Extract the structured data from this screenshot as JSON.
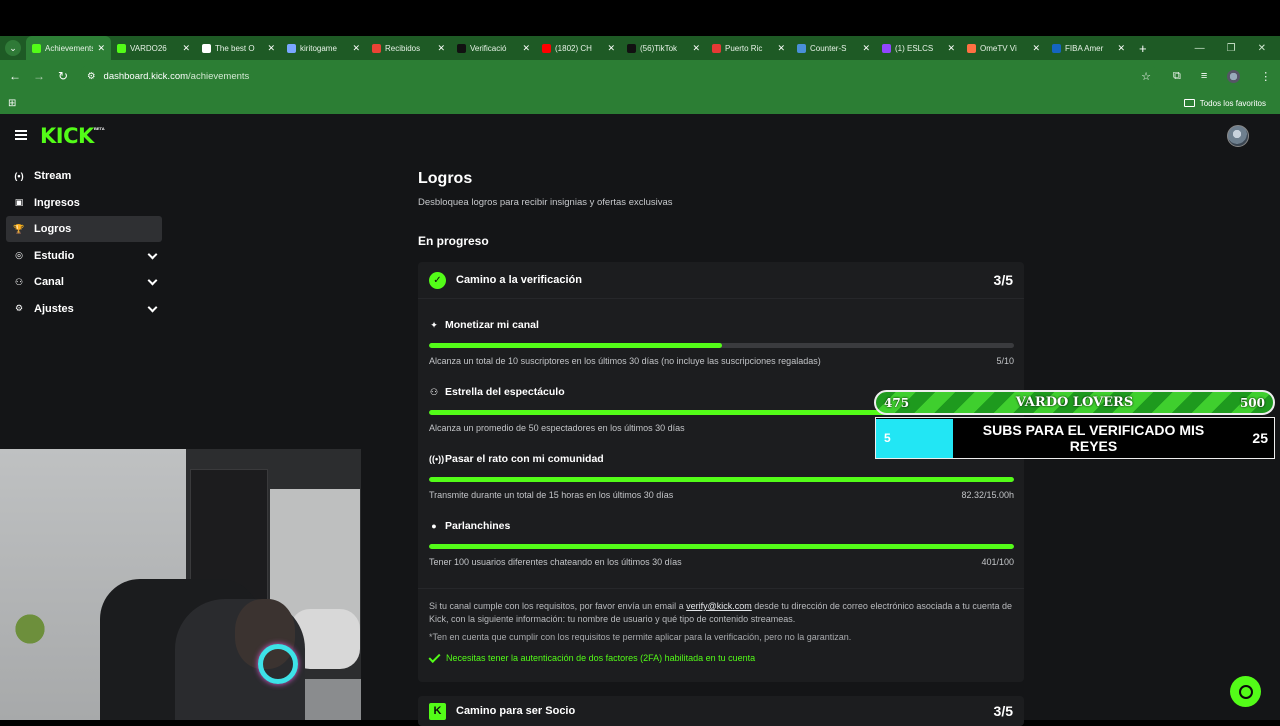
{
  "browser": {
    "tabs": [
      {
        "title": "Achievements",
        "active": true,
        "color": "#53fc18"
      },
      {
        "title": "VARDO26",
        "active": false,
        "color": "#53fc18"
      },
      {
        "title": "The best O",
        "active": false,
        "color": "#ffffff"
      },
      {
        "title": "kiritogame",
        "active": false,
        "color": "#7aa7ff"
      },
      {
        "title": "Recibidos",
        "active": false,
        "color": "#ea4335"
      },
      {
        "title": "Verificació",
        "active": false,
        "color": "#111111"
      },
      {
        "title": "(1802) CH",
        "active": false,
        "color": "#ff0000"
      },
      {
        "title": "(56)TikTok",
        "active": false,
        "color": "#111111"
      },
      {
        "title": "Puerto Ric",
        "active": false,
        "color": "#e53935"
      },
      {
        "title": "Counter-S",
        "active": false,
        "color": "#4a90d9"
      },
      {
        "title": "(1) ESLCS",
        "active": false,
        "color": "#9146ff"
      },
      {
        "title": "OmeTV Vi",
        "active": false,
        "color": "#ff7043"
      },
      {
        "title": "FIBA Amer",
        "active": false,
        "color": "#1565c0"
      }
    ],
    "url_host": "dashboard.kick.com",
    "url_path": "/achievements",
    "bookmarks_all": "Todos los favoritos"
  },
  "header": {
    "logo": "KICK",
    "logo_badge": "BETA"
  },
  "sidebar": {
    "items": [
      {
        "label": "Stream",
        "icon": "broadcast-icon",
        "glyph": "(•)"
      },
      {
        "label": "Ingresos",
        "icon": "revenue-icon",
        "glyph": "▣"
      },
      {
        "label": "Logros",
        "icon": "trophy-icon",
        "glyph": "🏆",
        "active": true
      },
      {
        "label": "Estudio",
        "icon": "studio-icon",
        "glyph": "◎"
      },
      {
        "label": "Canal",
        "icon": "channel-icon",
        "glyph": "⚇"
      },
      {
        "label": "Ajustes",
        "icon": "gear-icon",
        "glyph": "⚙"
      }
    ]
  },
  "main": {
    "title": "Logros",
    "subtitle": "Desbloquea logros para recibir insignias y ofertas exclusivas",
    "section": "En progreso",
    "card": {
      "title": "Camino a la verificación",
      "count": "3/5",
      "goals": [
        {
          "title": "Monetizar mi canal",
          "icon": "sparkle-icon",
          "glyph": "✦",
          "desc": "Alcanza un total de 10 suscriptores en los últimos 30 días (no incluye las suscripciones regaladas)",
          "value": "5/10",
          "progress": 0.5
        },
        {
          "title": "Estrella del espectáculo",
          "icon": "viewers-icon",
          "glyph": "⚇",
          "desc": "Alcanza un promedio de 50 espectadores en los últimos 30 días",
          "value": "",
          "progress": 1.0
        },
        {
          "title": "Pasar el rato con mi comunidad",
          "icon": "live-icon",
          "glyph": "((•))",
          "desc": "Transmite durante un total de 15 horas en los últimos 30 días",
          "value": "82.32/15.00h",
          "progress": 1.0
        },
        {
          "title": "Parlanchines",
          "icon": "chat-icon",
          "glyph": "●",
          "desc": "Tener 100 usuarios diferentes chateando en los últimos 30 días",
          "value": "401/100",
          "progress": 1.0
        }
      ],
      "info_before": "Si tu canal cumple con los requisitos, por favor envía un email a ",
      "info_email": "verify@kick.com",
      "info_after": " desde tu dirección de correo electrónico asociada a tu cuenta de Kick, con la siguiente información: tu nombre de usuario y qué tipo de contenido streameas.",
      "note": "*Ten en cuenta que cumplir con los requisitos te permite aplicar para la verificación, pero no la garantizan.",
      "twofa": "Necesitas tener la autenticación de dos factores (2FA) habilitada en tu cuenta"
    },
    "card2": {
      "title": "Camino para ser Socio",
      "count": "3/5"
    }
  },
  "overlay": {
    "subgoal": {
      "current": "475",
      "title": "VARDO LOVERS",
      "goal": "500"
    },
    "verify_goal": {
      "current": "5",
      "title": "SUBS PARA EL VERIFICADO MIS REYES",
      "goal": "25"
    }
  },
  "colors": {
    "accent": "#53fc18",
    "chrome": "#2c7e34",
    "bg": "#141517",
    "card": "#1c1d1f"
  }
}
